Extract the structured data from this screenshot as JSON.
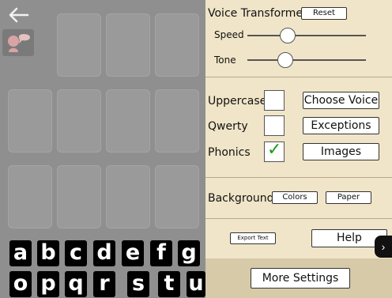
{
  "voice": {
    "title": "Voice Transformer",
    "reset_label": "Reset",
    "speed_label": "Speed",
    "tone_label": "Tone",
    "speed_value": 0.34,
    "tone_value": 0.32
  },
  "options": {
    "uppercase_label": "Uppercase",
    "uppercase_checked": false,
    "qwerty_label": "Qwerty",
    "qwerty_checked": false,
    "phonics_label": "Phonics",
    "phonics_checked": true,
    "check_glyph": "✓",
    "choose_voice_label": "Choose Voice",
    "exceptions_label": "Exceptions",
    "images_label": "Images"
  },
  "background": {
    "label": "Background",
    "colors_label": "Colors",
    "paper_label": "Paper"
  },
  "footer": {
    "export_label": "Export Text",
    "help_label": "Help",
    "more_label": "More Settings"
  },
  "toolbar": {
    "back_icon": "back-arrow-icon",
    "speak_icon": "speaking-heads-icon"
  },
  "keyboard": {
    "row1": [
      "a",
      "b",
      "c",
      "d",
      "e",
      "f",
      "g"
    ],
    "row2": [
      "o",
      "p",
      "q",
      "r",
      "s",
      "t",
      "u"
    ]
  },
  "colors": {
    "panel_bg": "#f0e5c8",
    "left_bg": "#8f8f8f",
    "check_green": "#1a9a1a"
  }
}
